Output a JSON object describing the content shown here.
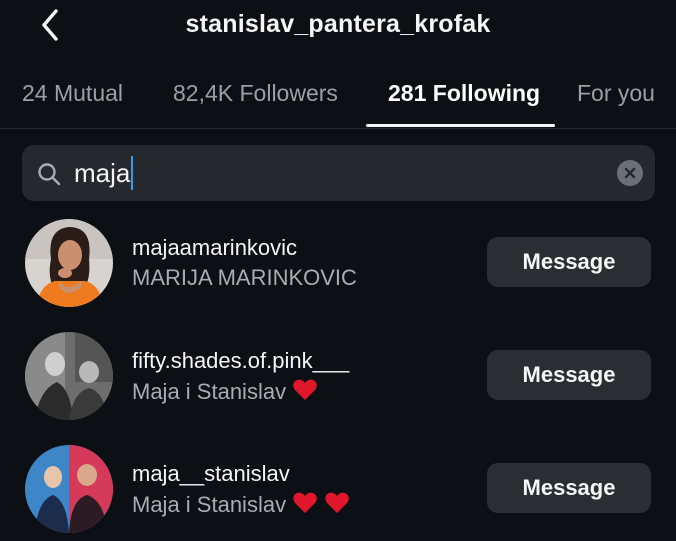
{
  "header": {
    "title": "stanislav_pantera_krofak",
    "back_icon": "chevron-left-icon"
  },
  "tabs": [
    {
      "label": "24 Mutual",
      "active": false
    },
    {
      "label": "82,4K Followers",
      "active": false
    },
    {
      "label": "281 Following",
      "active": true
    },
    {
      "label": "For you",
      "active": false
    }
  ],
  "search": {
    "value": "maja",
    "search_icon": "search-icon",
    "clear_icon": "clear-icon"
  },
  "results": [
    {
      "username": "majaamarinkovic",
      "full_name": "MARIJA MARINKOVIC",
      "hearts": 0,
      "button": "Message"
    },
    {
      "username": "fifty.shades.of.pink___",
      "full_name": "Maja i Stanislav",
      "hearts": 1,
      "button": "Message"
    },
    {
      "username": "maja__stanislav",
      "full_name": "Maja i Stanislav",
      "hearts": 2,
      "button": "Message"
    }
  ],
  "colors": {
    "background": "#0c1014",
    "button": "#2a2e33",
    "heart": "#e0162b",
    "caret": "#3897f0"
  }
}
